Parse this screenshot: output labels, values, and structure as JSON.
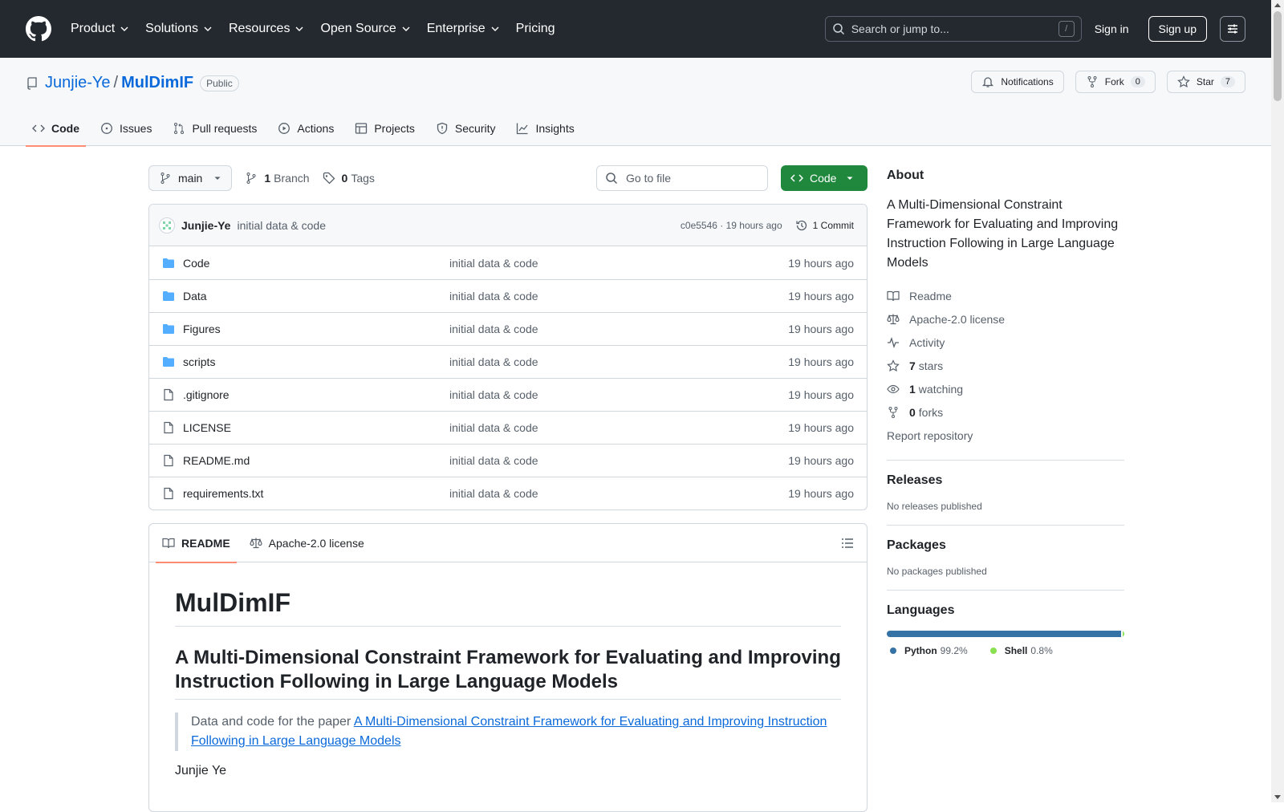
{
  "header": {
    "nav": [
      "Product",
      "Solutions",
      "Resources",
      "Open Source",
      "Enterprise",
      "Pricing"
    ],
    "search_placeholder": "Search or jump to...",
    "search_key": "/",
    "signin": "Sign in",
    "signup": "Sign up"
  },
  "repo": {
    "owner": "Junjie-Ye",
    "separator": "/",
    "name": "MulDimIF",
    "visibility": "Public",
    "notifications": "Notifications",
    "fork_label": "Fork",
    "fork_count": "0",
    "star_label": "Star",
    "star_count": "7",
    "tabs": [
      "Code",
      "Issues",
      "Pull requests",
      "Actions",
      "Projects",
      "Security",
      "Insights"
    ]
  },
  "file_nav": {
    "branch": "main",
    "branches_count": "1",
    "branches_label": "Branch",
    "tags_count": "0",
    "tags_label": "Tags",
    "goto_placeholder": "Go to file",
    "code_button": "Code"
  },
  "commit": {
    "author": "Junjie-Ye",
    "message": "initial data & code",
    "hash_time": "c0e5546 · 19 hours ago",
    "commits": "1 Commit"
  },
  "files": [
    {
      "name": "Code",
      "type": "folder",
      "message": "initial data & code",
      "age": "19 hours ago"
    },
    {
      "name": "Data",
      "type": "folder",
      "message": "initial data & code",
      "age": "19 hours ago"
    },
    {
      "name": "Figures",
      "type": "folder",
      "message": "initial data & code",
      "age": "19 hours ago"
    },
    {
      "name": "scripts",
      "type": "folder",
      "message": "initial data & code",
      "age": "19 hours ago"
    },
    {
      "name": ".gitignore",
      "type": "file",
      "message": "initial data & code",
      "age": "19 hours ago"
    },
    {
      "name": "LICENSE",
      "type": "file",
      "message": "initial data & code",
      "age": "19 hours ago"
    },
    {
      "name": "README.md",
      "type": "file",
      "message": "initial data & code",
      "age": "19 hours ago"
    },
    {
      "name": "requirements.txt",
      "type": "file",
      "message": "initial data & code",
      "age": "19 hours ago"
    }
  ],
  "readme": {
    "tab_readme": "README",
    "tab_license": "Apache-2.0 license",
    "h1": "MulDimIF",
    "h2": "A Multi-Dimensional Constraint Framework for Evaluating and Improving Instruction Following in Large Language Models",
    "quote_prefix": "Data and code for the paper ",
    "quote_link": "A Multi-Dimensional Constraint Framework for Evaluating and Improving Instruction Following in Large Language Models",
    "author": "Junjie Ye"
  },
  "about": {
    "heading": "About",
    "description": "A Multi-Dimensional Constraint Framework for Evaluating and Improving Instruction Following in Large Language Models",
    "readme": "Readme",
    "license": "Apache-2.0 license",
    "activity": "Activity",
    "stars_count": "7",
    "stars_label": "stars",
    "watching_count": "1",
    "watching_label": "watching",
    "forks_count": "0",
    "forks_label": "forks",
    "report": "Report repository"
  },
  "releases": {
    "heading": "Releases",
    "text": "No releases published"
  },
  "packages": {
    "heading": "Packages",
    "text": "No packages published"
  },
  "languages": {
    "heading": "Languages",
    "items": [
      {
        "name": "Python",
        "percent": "99.2%",
        "share": 99.2,
        "color": "#3572A5"
      },
      {
        "name": "Shell",
        "percent": "0.8%",
        "share": 0.8,
        "color": "#89e051"
      }
    ]
  },
  "colors": {
    "header_bg": "#24292f",
    "primary_button": "#1f883d",
    "link": "#0969da",
    "tab_underline": "#fd8c73"
  }
}
